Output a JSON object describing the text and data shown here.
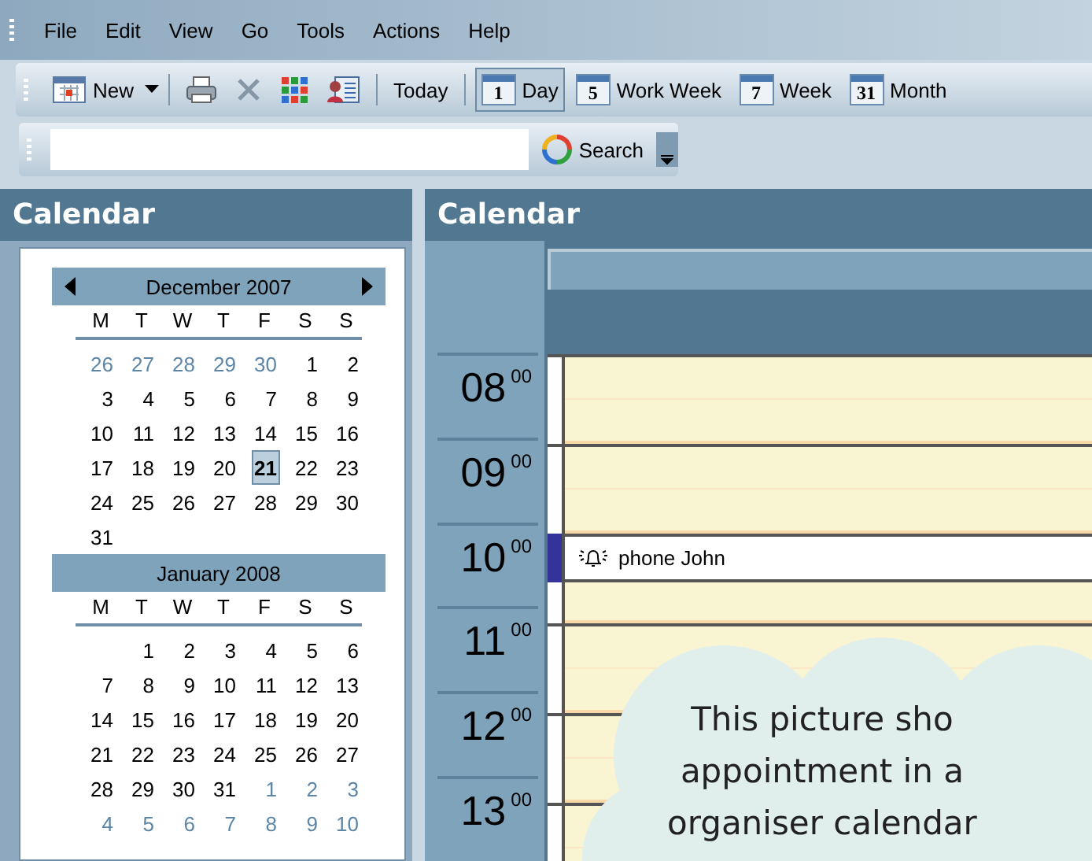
{
  "menu": [
    {
      "label": "File"
    },
    {
      "label": "Edit"
    },
    {
      "label": "View"
    },
    {
      "label": "Go"
    },
    {
      "label": "Tools"
    },
    {
      "label": "Actions"
    },
    {
      "label": "Help"
    }
  ],
  "toolbar": [
    {
      "kind": "new",
      "label": "New"
    },
    {
      "kind": "separator"
    },
    {
      "kind": "print"
    },
    {
      "kind": "delete"
    },
    {
      "kind": "grid"
    },
    {
      "kind": "contact"
    },
    {
      "kind": "separator"
    },
    {
      "kind": "text",
      "label": "Today",
      "selected": false
    },
    {
      "kind": "separator"
    },
    {
      "kind": "view",
      "icon_text": "1",
      "label": "Day",
      "selected": true
    },
    {
      "kind": "view",
      "icon_text": "5",
      "label": "Work Week",
      "selected": false
    },
    {
      "kind": "view",
      "icon_text": "7",
      "label": "Week",
      "selected": false
    },
    {
      "kind": "view",
      "icon_text": "31",
      "label": "Month",
      "selected": false
    }
  ],
  "search": {
    "button": "Search"
  },
  "navigation_pane": {
    "title": "Calendar",
    "months": [
      {
        "title": "December 2007",
        "nav": true,
        "weekdays": [
          "M",
          "T",
          "W",
          "T",
          "F",
          "S",
          "S"
        ],
        "weeks": [
          {
            "days": [
              {
                "kind": "day",
                "d": "26",
                "other_month": true,
                "selected": false
              },
              {
                "kind": "day",
                "d": "27",
                "other_month": true,
                "selected": false
              },
              {
                "kind": "day",
                "d": "28",
                "other_month": true,
                "selected": false
              },
              {
                "kind": "day",
                "d": "29",
                "other_month": true,
                "selected": false
              },
              {
                "kind": "day",
                "d": "30",
                "other_month": true,
                "selected": false
              },
              {
                "kind": "day",
                "d": "1",
                "other_month": false,
                "selected": false
              },
              {
                "kind": "day",
                "d": "2",
                "other_month": false,
                "selected": false
              }
            ]
          },
          {
            "days": [
              {
                "kind": "day",
                "d": "3",
                "other_month": false,
                "selected": false
              },
              {
                "kind": "day",
                "d": "4",
                "other_month": false,
                "selected": false
              },
              {
                "kind": "day",
                "d": "5",
                "other_month": false,
                "selected": false
              },
              {
                "kind": "day",
                "d": "6",
                "other_month": false,
                "selected": false
              },
              {
                "kind": "day",
                "d": "7",
                "other_month": false,
                "selected": false
              },
              {
                "kind": "day",
                "d": "8",
                "other_month": false,
                "selected": false
              },
              {
                "kind": "day",
                "d": "9",
                "other_month": false,
                "selected": false
              }
            ]
          },
          {
            "days": [
              {
                "kind": "day",
                "d": "10",
                "other_month": false,
                "selected": false
              },
              {
                "kind": "day",
                "d": "11",
                "other_month": false,
                "selected": false
              },
              {
                "kind": "day",
                "d": "12",
                "other_month": false,
                "selected": false
              },
              {
                "kind": "day",
                "d": "13",
                "other_month": false,
                "selected": false
              },
              {
                "kind": "day",
                "d": "14",
                "other_month": false,
                "selected": false
              },
              {
                "kind": "day",
                "d": "15",
                "other_month": false,
                "selected": false
              },
              {
                "kind": "day",
                "d": "16",
                "other_month": false,
                "selected": false
              }
            ]
          },
          {
            "days": [
              {
                "kind": "day",
                "d": "17",
                "other_month": false,
                "selected": false
              },
              {
                "kind": "day",
                "d": "18",
                "other_month": false,
                "selected": false
              },
              {
                "kind": "day",
                "d": "19",
                "other_month": false,
                "selected": false
              },
              {
                "kind": "day",
                "d": "20",
                "other_month": false,
                "selected": false
              },
              {
                "kind": "day",
                "d": "21",
                "other_month": false,
                "selected": true
              },
              {
                "kind": "day",
                "d": "22",
                "other_month": false,
                "selected": false
              },
              {
                "kind": "day",
                "d": "23",
                "other_month": false,
                "selected": false
              }
            ]
          },
          {
            "days": [
              {
                "kind": "day",
                "d": "24",
                "other_month": false,
                "selected": false
              },
              {
                "kind": "day",
                "d": "25",
                "other_month": false,
                "selected": false
              },
              {
                "kind": "day",
                "d": "26",
                "other_month": false,
                "selected": false
              },
              {
                "kind": "day",
                "d": "27",
                "other_month": false,
                "selected": false
              },
              {
                "kind": "day",
                "d": "28",
                "other_month": false,
                "selected": false
              },
              {
                "kind": "day",
                "d": "29",
                "other_month": false,
                "selected": false
              },
              {
                "kind": "day",
                "d": "30",
                "other_month": false,
                "selected": false
              }
            ]
          },
          {
            "days": [
              {
                "kind": "day",
                "d": "31",
                "other_month": false,
                "selected": false
              }
            ]
          }
        ]
      },
      {
        "title": "January 2008",
        "nav": false,
        "weekdays": [
          "M",
          "T",
          "W",
          "T",
          "F",
          "S",
          "S"
        ],
        "weeks": [
          {
            "days": [
              {
                "kind": "blank"
              },
              {
                "kind": "day",
                "d": "1",
                "other_month": false,
                "selected": false
              },
              {
                "kind": "day",
                "d": "2",
                "other_month": false,
                "selected": false
              },
              {
                "kind": "day",
                "d": "3",
                "other_month": false,
                "selected": false
              },
              {
                "kind": "day",
                "d": "4",
                "other_month": false,
                "selected": false
              },
              {
                "kind": "day",
                "d": "5",
                "other_month": false,
                "selected": false
              },
              {
                "kind": "day",
                "d": "6",
                "other_month": false,
                "selected": false
              }
            ]
          },
          {
            "days": [
              {
                "kind": "day",
                "d": "7",
                "other_month": false,
                "selected": false
              },
              {
                "kind": "day",
                "d": "8",
                "other_month": false,
                "selected": false
              },
              {
                "kind": "day",
                "d": "9",
                "other_month": false,
                "selected": false
              },
              {
                "kind": "day",
                "d": "10",
                "other_month": false,
                "selected": false
              },
              {
                "kind": "day",
                "d": "11",
                "other_month": false,
                "selected": false
              },
              {
                "kind": "day",
                "d": "12",
                "other_month": false,
                "selected": false
              },
              {
                "kind": "day",
                "d": "13",
                "other_month": false,
                "selected": false
              }
            ]
          },
          {
            "days": [
              {
                "kind": "day",
                "d": "14",
                "other_month": false,
                "selected": false
              },
              {
                "kind": "day",
                "d": "15",
                "other_month": false,
                "selected": false
              },
              {
                "kind": "day",
                "d": "16",
                "other_month": false,
                "selected": false
              },
              {
                "kind": "day",
                "d": "17",
                "other_month": false,
                "selected": false
              },
              {
                "kind": "day",
                "d": "18",
                "other_month": false,
                "selected": false
              },
              {
                "kind": "day",
                "d": "19",
                "other_month": false,
                "selected": false
              },
              {
                "kind": "day",
                "d": "20",
                "other_month": false,
                "selected": false
              }
            ]
          },
          {
            "days": [
              {
                "kind": "day",
                "d": "21",
                "other_month": false,
                "selected": false
              },
              {
                "kind": "day",
                "d": "22",
                "other_month": false,
                "selected": false
              },
              {
                "kind": "day",
                "d": "23",
                "other_month": false,
                "selected": false
              },
              {
                "kind": "day",
                "d": "24",
                "other_month": false,
                "selected": false
              },
              {
                "kind": "day",
                "d": "25",
                "other_month": false,
                "selected": false
              },
              {
                "kind": "day",
                "d": "26",
                "other_month": false,
                "selected": false
              },
              {
                "kind": "day",
                "d": "27",
                "other_month": false,
                "selected": false
              }
            ]
          },
          {
            "days": [
              {
                "kind": "day",
                "d": "28",
                "other_month": false,
                "selected": false
              },
              {
                "kind": "day",
                "d": "29",
                "other_month": false,
                "selected": false
              },
              {
                "kind": "day",
                "d": "30",
                "other_month": false,
                "selected": false
              },
              {
                "kind": "day",
                "d": "31",
                "other_month": false,
                "selected": false
              },
              {
                "kind": "day",
                "d": "1",
                "other_month": true,
                "selected": false
              },
              {
                "kind": "day",
                "d": "2",
                "other_month": true,
                "selected": false
              },
              {
                "kind": "day",
                "d": "3",
                "other_month": true,
                "selected": false
              }
            ]
          },
          {
            "days": [
              {
                "kind": "day",
                "d": "4",
                "other_month": true,
                "selected": false
              },
              {
                "kind": "day",
                "d": "5",
                "other_month": true,
                "selected": false
              },
              {
                "kind": "day",
                "d": "6",
                "other_month": true,
                "selected": false
              },
              {
                "kind": "day",
                "d": "7",
                "other_month": true,
                "selected": false
              },
              {
                "kind": "day",
                "d": "8",
                "other_month": true,
                "selected": false
              },
              {
                "kind": "day",
                "d": "9",
                "other_month": true,
                "selected": false
              },
              {
                "kind": "day",
                "d": "10",
                "other_month": true,
                "selected": false
              }
            ]
          }
        ]
      }
    ]
  },
  "calendar": {
    "title": "Calendar",
    "hours": [
      {
        "hour": "08",
        "minutes": "00"
      },
      {
        "hour": "09",
        "minutes": "00"
      },
      {
        "hour": "10",
        "minutes": "00",
        "appointment": {
          "title": "phone John",
          "reminder": true
        }
      },
      {
        "hour": "11",
        "minutes": "00"
      },
      {
        "hour": "12",
        "minutes": "00"
      },
      {
        "hour": "13",
        "minutes": "00"
      }
    ]
  },
  "callout": {
    "lines": [
      "This picture sho",
      "appointment in a",
      "organiser calendar"
    ]
  }
}
